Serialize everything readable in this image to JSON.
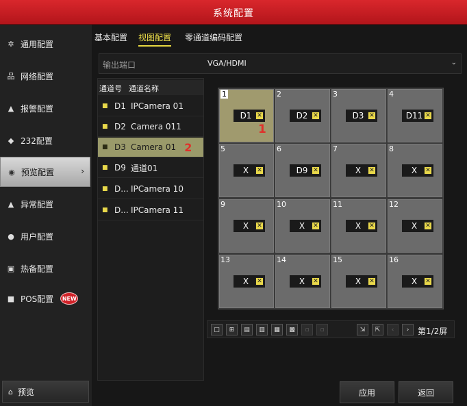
{
  "window": {
    "title": "系统配置"
  },
  "sidebar": {
    "items": [
      {
        "label": "通用配置",
        "icon": "gear-icon"
      },
      {
        "label": "网络配置",
        "icon": "network-icon"
      },
      {
        "label": "报警配置",
        "icon": "bell-icon"
      },
      {
        "label": "232配置",
        "icon": "serial-icon"
      },
      {
        "label": "预览配置",
        "icon": "eye-icon"
      },
      {
        "label": "异常配置",
        "icon": "warning-icon"
      },
      {
        "label": "用户配置",
        "icon": "users-icon"
      },
      {
        "label": "热备配置",
        "icon": "backup-icon"
      },
      {
        "label": "POS配置",
        "icon": "pos-icon"
      }
    ],
    "new_badge": "NEW",
    "preview_label": "预览"
  },
  "tabs": [
    {
      "label": "基本配置"
    },
    {
      "label": "视图配置"
    },
    {
      "label": "零通道编码配置"
    }
  ],
  "output": {
    "label": "输出端口",
    "value": "VGA/HDMI"
  },
  "channel_list": {
    "header_num": "通道号",
    "header_name": "通道名称",
    "rows": [
      {
        "num": "D1",
        "name": "IPCamera 01"
      },
      {
        "num": "D2",
        "name": "Camera 011"
      },
      {
        "num": "D3",
        "name": "Camera 01"
      },
      {
        "num": "D9",
        "name": "通道01"
      },
      {
        "num": "D...",
        "name": "IPCamera 10"
      },
      {
        "num": "D...",
        "name": "IPCamera 11"
      }
    ],
    "selected_mark": "2"
  },
  "grid": {
    "cells": [
      {
        "idx": "1",
        "ch": "D1"
      },
      {
        "idx": "2",
        "ch": "D2"
      },
      {
        "idx": "3",
        "ch": "D3"
      },
      {
        "idx": "4",
        "ch": "D11"
      },
      {
        "idx": "5",
        "ch": "X"
      },
      {
        "idx": "6",
        "ch": "D9"
      },
      {
        "idx": "7",
        "ch": "X"
      },
      {
        "idx": "8",
        "ch": "X"
      },
      {
        "idx": "9",
        "ch": "X"
      },
      {
        "idx": "10",
        "ch": "X"
      },
      {
        "idx": "11",
        "ch": "X"
      },
      {
        "idx": "12",
        "ch": "X"
      },
      {
        "idx": "13",
        "ch": "X"
      },
      {
        "idx": "14",
        "ch": "X"
      },
      {
        "idx": "15",
        "ch": "X"
      },
      {
        "idx": "16",
        "ch": "X"
      }
    ],
    "selected_mark": "1"
  },
  "pager": {
    "text": "第1/2屏"
  },
  "buttons": {
    "apply": "应用",
    "back": "返回"
  }
}
